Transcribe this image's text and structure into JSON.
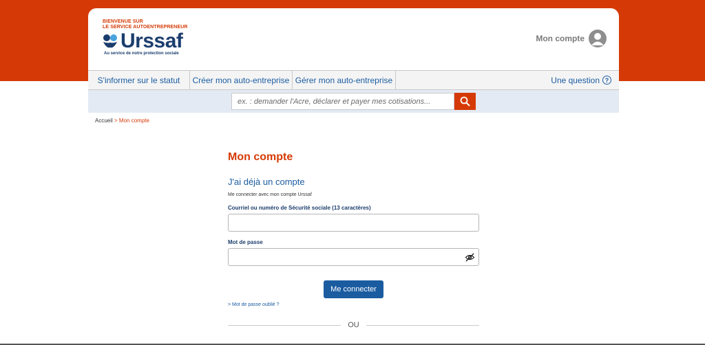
{
  "header": {
    "tagline_line1": "BIENVENUE SUR",
    "tagline_line2": "LE SERVICE AUTOENTREPRENEUR",
    "logo_word": "Urssaf",
    "logo_subtitle": "Au service de notre protection sociale",
    "account_label": "Mon compte",
    "avatar_icon": "user-avatar-icon"
  },
  "nav": {
    "items": [
      {
        "label": "S'informer sur le statut"
      },
      {
        "label": "Créer mon auto-entreprise"
      },
      {
        "label": "Gérer mon auto-entreprise"
      }
    ],
    "question_label": "Une question",
    "question_icon": "?"
  },
  "search": {
    "placeholder": "ex. : demander l'Acre, déclarer et payer mes cotisations...",
    "button_icon": "search-icon"
  },
  "breadcrumb": {
    "home": "Accueil",
    "separator": " > ",
    "current": "Mon compte"
  },
  "main": {
    "page_title": "Mon compte",
    "section_title": "J'ai déjà un compte",
    "helper_text": "Me connecter avec mon compte Urssaf",
    "email_label": "Courriel ou numéro de Sécurité sociale (13 caractères)",
    "email_value": "",
    "password_label": "Mot de passe",
    "password_value": "",
    "connect_button": "Me connecter",
    "forgot_link": "> Mot de passe oublié ?",
    "separator_text": "OU"
  },
  "colors": {
    "brand_orange": "#d53a06",
    "brand_blue": "#1b5ca1",
    "brand_navy": "#1b3d6d"
  }
}
